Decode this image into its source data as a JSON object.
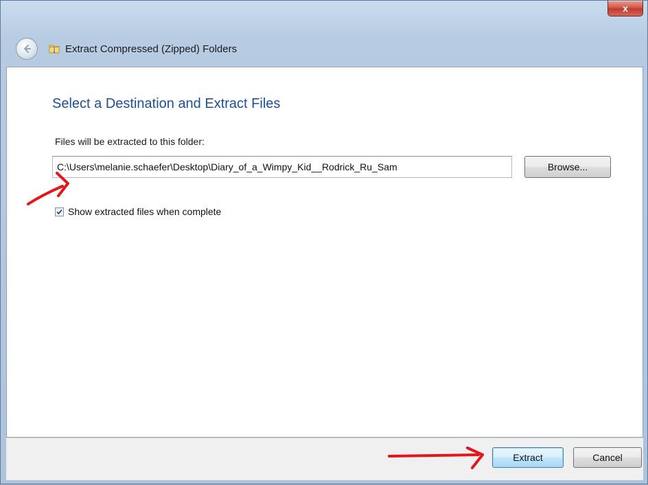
{
  "window": {
    "title": "Extract Compressed (Zipped) Folders",
    "close_label": "x"
  },
  "page": {
    "heading": "Select a Destination and Extract Files",
    "destination_label": "Files will be extracted to this folder:",
    "destination_value": "C:\\Users\\melanie.schaefer\\Desktop\\Diary_of_a_Wimpy_Kid__Rodrick_Ru_Sam",
    "browse_label": "Browse...",
    "show_files_label": "Show extracted files when complete",
    "show_files_checked": true
  },
  "footer": {
    "extract_label": "Extract",
    "cancel_label": "Cancel"
  },
  "icons": {
    "back": "back-arrow-icon",
    "folder": "zipped-folder-icon",
    "check": "checkmark-icon"
  },
  "colors": {
    "heading": "#1e4e96",
    "annotation": "#e3161a",
    "close": "#c13b2b"
  }
}
